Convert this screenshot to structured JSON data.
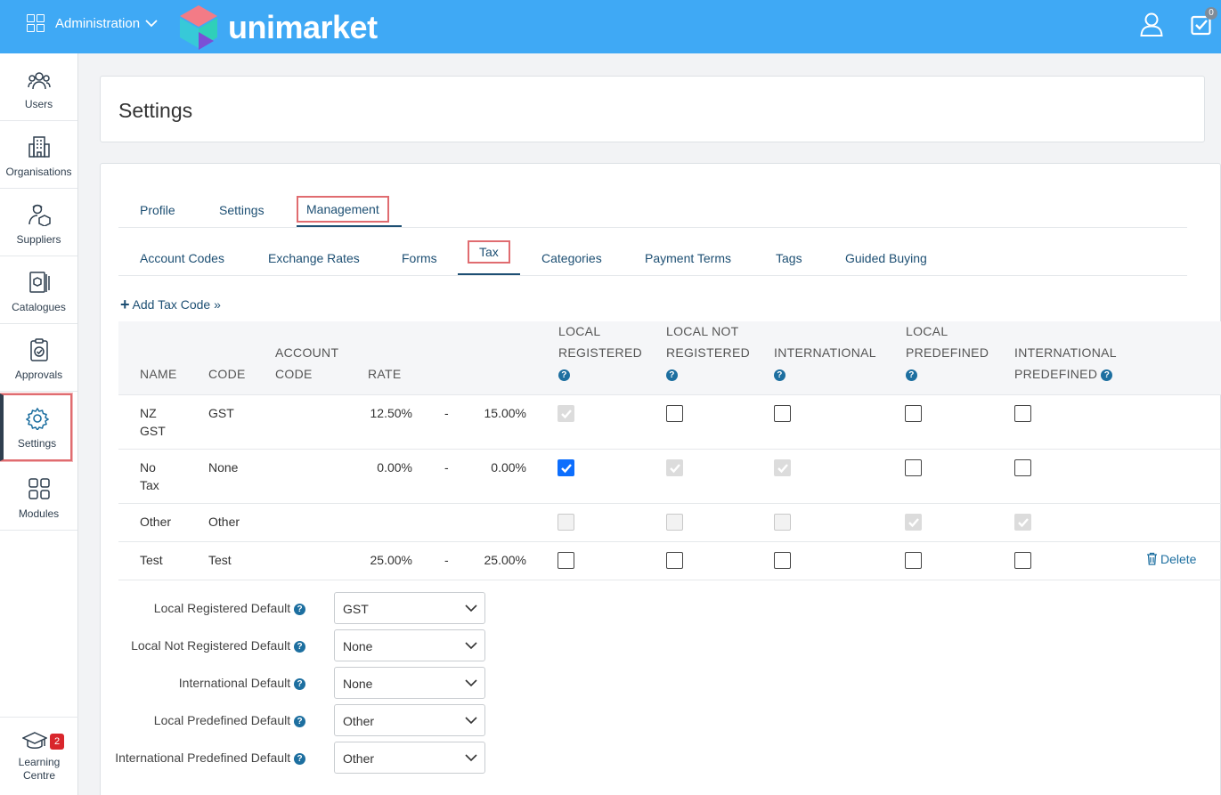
{
  "header": {
    "admin_label": "Administration",
    "logo_text": "unimarket",
    "tasks_count": "0"
  },
  "sidebar": {
    "items": [
      {
        "label": "Users",
        "icon": "users-icon"
      },
      {
        "label": "Organisations",
        "icon": "building-icon"
      },
      {
        "label": "Suppliers",
        "icon": "supplier-icon"
      },
      {
        "label": "Catalogues",
        "icon": "catalogue-icon"
      },
      {
        "label": "Approvals",
        "icon": "approval-icon"
      },
      {
        "label": "Settings",
        "icon": "gear-icon"
      },
      {
        "label": "Modules",
        "icon": "modules-icon"
      }
    ],
    "learning": {
      "label_1": "Learning",
      "label_2": "Centre",
      "badge": "2"
    }
  },
  "page_title": "Settings",
  "tabs": {
    "profile": "Profile",
    "settings": "Settings",
    "management": "Management"
  },
  "subtabs": {
    "account_codes": "Account Codes",
    "exchange_rates": "Exchange Rates",
    "forms": "Forms",
    "tax": "Tax",
    "categories": "Categories",
    "payment_terms": "Payment Terms",
    "tags": "Tags",
    "guided_buying": "Guided Buying"
  },
  "add_tax_code": "Add Tax Code »",
  "table": {
    "headers": {
      "name": "NAME",
      "code": "CODE",
      "account_1": "ACCOUNT",
      "account_2": "CODE",
      "rate": "RATE",
      "local_reg_1": "LOCAL",
      "local_reg_2": "REGISTERED",
      "local_not_1": "LOCAL NOT",
      "local_not_2": "REGISTERED",
      "international": "INTERNATIONAL",
      "local_pre_1": "LOCAL",
      "local_pre_2": "PREDEFINED",
      "intl_pre_1": "INTERNATIONAL",
      "intl_pre_2": "PREDEFINED"
    },
    "rows": [
      {
        "name_1": "NZ",
        "name_2": "GST",
        "code": "GST",
        "rate_min": "12.50%",
        "dash": "-",
        "rate_max": "15.00%",
        "checks": [
          "dison",
          "off",
          "off",
          "off",
          "off"
        ]
      },
      {
        "name_1": "No",
        "name_2": "Tax",
        "code": "None",
        "rate_min": "0.00%",
        "dash": "-",
        "rate_max": "0.00%",
        "checks": [
          "on",
          "dison",
          "dison",
          "off",
          "off"
        ]
      },
      {
        "name_1": "Other",
        "name_2": "",
        "code": "Other",
        "rate_min": "",
        "dash": "",
        "rate_max": "",
        "checks": [
          "dis",
          "dis",
          "dis",
          "dison",
          "dison"
        ]
      },
      {
        "name_1": "Test",
        "name_2": "",
        "code": "Test",
        "rate_min": "25.00%",
        "dash": "-",
        "rate_max": "25.00%",
        "checks": [
          "off",
          "off",
          "off",
          "off",
          "off"
        ],
        "delete": "Delete"
      }
    ]
  },
  "defaults": [
    {
      "label": "Local Registered Default",
      "value": "GST"
    },
    {
      "label": "Local Not Registered Default",
      "value": "None"
    },
    {
      "label": "International Default",
      "value": "None"
    },
    {
      "label": "Local Predefined Default",
      "value": "Other"
    },
    {
      "label": "International Predefined Default",
      "value": "Other"
    }
  ],
  "colors": {
    "topbar": "#3fa9f5",
    "link": "#1d4f73",
    "highlight": "#e06c70",
    "checked": "#0d6efd"
  }
}
